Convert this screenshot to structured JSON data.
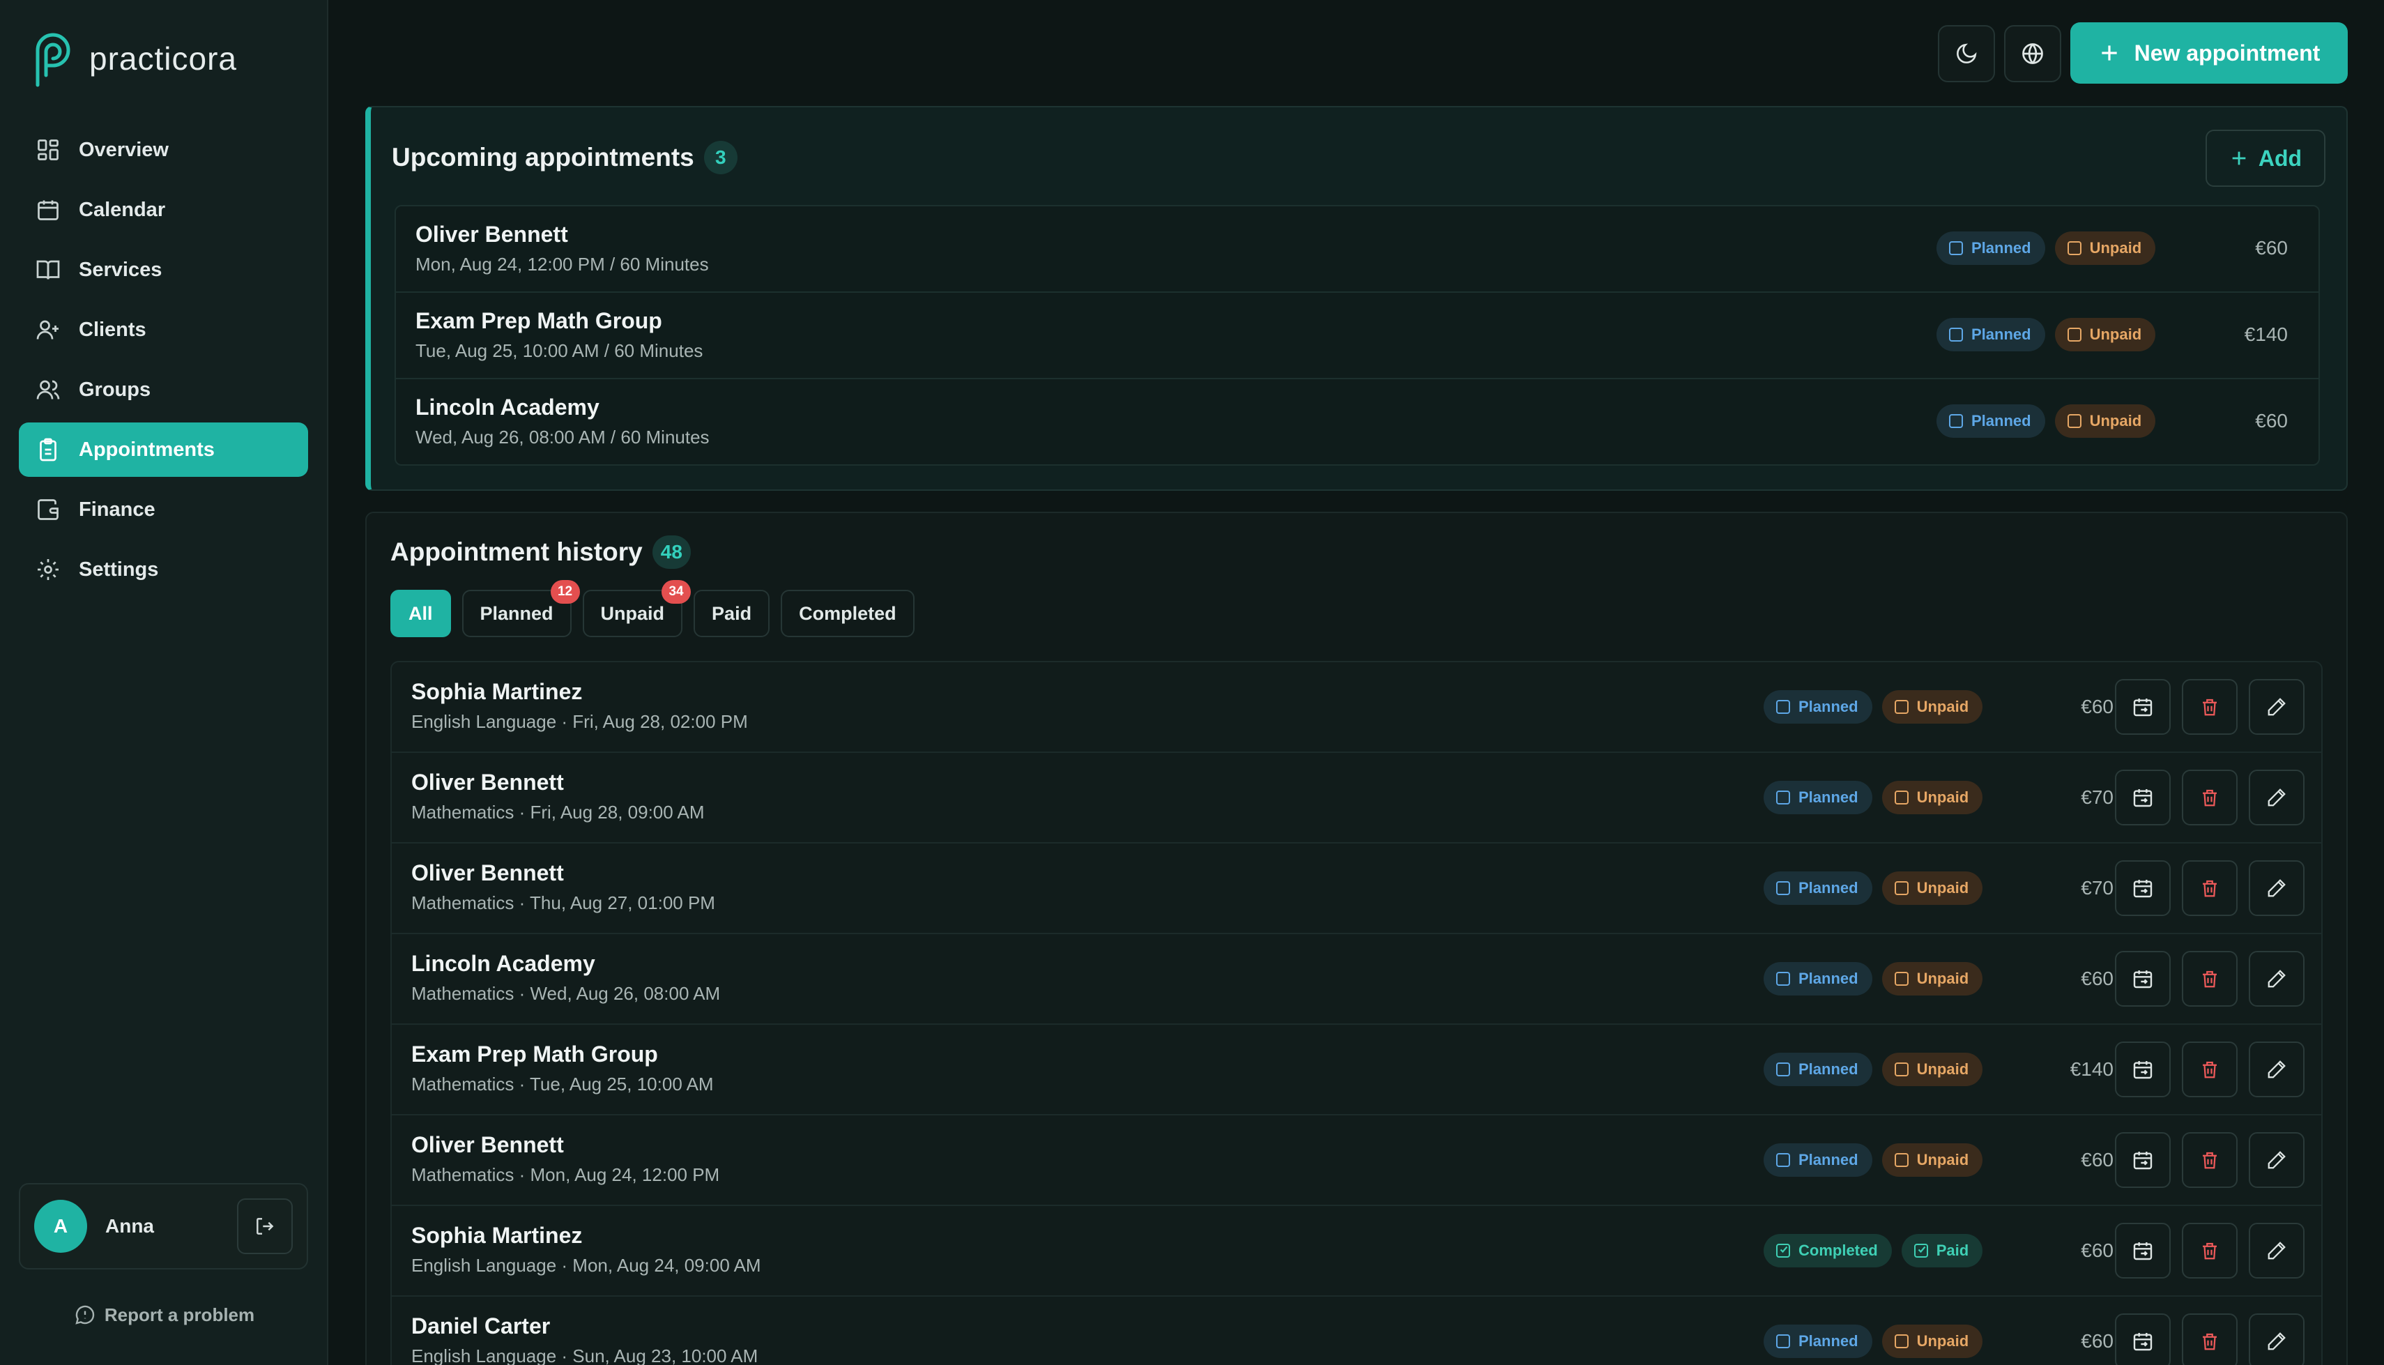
{
  "app": {
    "logo_text": "practicora"
  },
  "nav": [
    {
      "label": "Overview",
      "icon": "grid-icon"
    },
    {
      "label": "Calendar",
      "icon": "calendar-icon"
    },
    {
      "label": "Services",
      "icon": "book-icon"
    },
    {
      "label": "Clients",
      "icon": "user-plus-icon"
    },
    {
      "label": "Groups",
      "icon": "users-icon"
    },
    {
      "label": "Appointments",
      "icon": "clipboard-icon",
      "active": true
    },
    {
      "label": "Finance",
      "icon": "wallet-icon"
    },
    {
      "label": "Settings",
      "icon": "gear-icon"
    }
  ],
  "user": {
    "initial": "A",
    "name": "Anna"
  },
  "report_label": "Report a problem",
  "toolbar": {
    "new_appointment_label": "New appointment"
  },
  "upcoming": {
    "title": "Upcoming appointments",
    "count": "3",
    "add_label": "Add",
    "rows": [
      {
        "name": "Oliver Bennett",
        "sub": "Mon, Aug 24, 12:00 PM / 60 Minutes",
        "status": "Planned",
        "payment": "Unpaid",
        "price": "€60"
      },
      {
        "name": "Exam Prep Math Group",
        "sub": "Tue, Aug 25, 10:00 AM / 60 Minutes",
        "status": "Planned",
        "payment": "Unpaid",
        "price": "€140"
      },
      {
        "name": "Lincoln Academy",
        "sub": "Wed, Aug 26, 08:00 AM / 60 Minutes",
        "status": "Planned",
        "payment": "Unpaid",
        "price": "€60"
      }
    ]
  },
  "history": {
    "title": "Appointment history",
    "count": "48",
    "filters": [
      {
        "label": "All",
        "active": true,
        "badge": ""
      },
      {
        "label": "Planned",
        "active": false,
        "badge": "12"
      },
      {
        "label": "Unpaid",
        "active": false,
        "badge": "34"
      },
      {
        "label": "Paid",
        "active": false,
        "badge": ""
      },
      {
        "label": "Completed",
        "active": false,
        "badge": ""
      }
    ],
    "rows": [
      {
        "name": "Sophia Martinez",
        "sub": "English Language · Fri, Aug 28, 02:00 PM",
        "status": "Planned",
        "payment": "Unpaid",
        "price": "€60"
      },
      {
        "name": "Oliver Bennett",
        "sub": "Mathematics · Fri, Aug 28, 09:00 AM",
        "status": "Planned",
        "payment": "Unpaid",
        "price": "€70"
      },
      {
        "name": "Oliver Bennett",
        "sub": "Mathematics · Thu, Aug 27, 01:00 PM",
        "status": "Planned",
        "payment": "Unpaid",
        "price": "€70"
      },
      {
        "name": "Lincoln Academy",
        "sub": "Mathematics · Wed, Aug 26, 08:00 AM",
        "status": "Planned",
        "payment": "Unpaid",
        "price": "€60"
      },
      {
        "name": "Exam Prep Math Group",
        "sub": "Mathematics · Tue, Aug 25, 10:00 AM",
        "status": "Planned",
        "payment": "Unpaid",
        "price": "€140"
      },
      {
        "name": "Oliver Bennett",
        "sub": "Mathematics · Mon, Aug 24, 12:00 PM",
        "status": "Planned",
        "payment": "Unpaid",
        "price": "€60"
      },
      {
        "name": "Sophia Martinez",
        "sub": "English Language · Mon, Aug 24, 09:00 AM",
        "status": "Completed",
        "payment": "Paid",
        "price": "€60"
      },
      {
        "name": "Daniel Carter",
        "sub": "English Language · Sun, Aug 23, 10:00 AM",
        "status": "Planned",
        "payment": "Unpaid",
        "price": "€60"
      }
    ]
  },
  "colors": {
    "accent": "#1fb3a3",
    "background": "#0d1615",
    "planned": "#5ea7e6",
    "unpaid": "#e6a765",
    "danger": "#ee5a5a"
  }
}
